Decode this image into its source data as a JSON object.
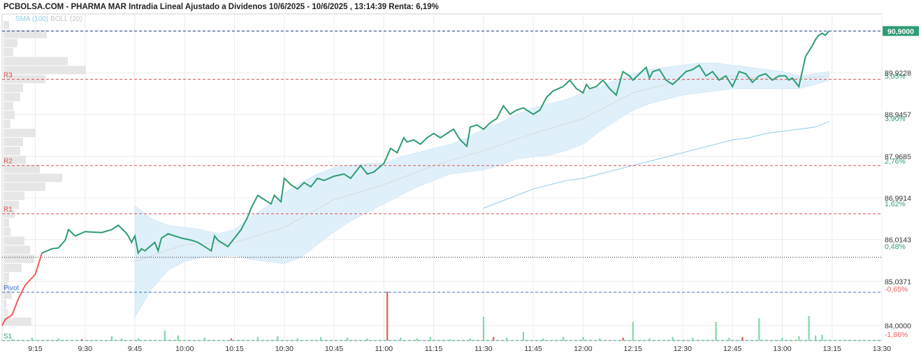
{
  "title": "PCBOLSA.COM - PHARMA MAR Intradia Lineal Ajustado a Dividenos 10/6/2025 - 10/6/2025 , 13:14:39 Renta: 6,19%",
  "legend": {
    "sma": "SMA (100)",
    "boll": "BOLL (20)"
  },
  "colors": {
    "price_up": "#2e9c72",
    "price_down": "#ef5a5a",
    "sma": "#8ccbe8",
    "boll_fill": "#dff0fb",
    "boll_line": "#d9d9d9",
    "volume_up": "#7ed9a6",
    "volume_down": "#ef5a5a",
    "level_resistance": "#e05050",
    "level_pivot": "#3c6fc2",
    "level_support": "#2e9c72",
    "last_price": "#233b8c",
    "grid": "#ececec",
    "volume_profile": "#e6e6e6"
  },
  "chart_data": {
    "type": "line",
    "title": "PCBOLSA.COM - PHARMA MAR Intradia Lineal Ajustado a Dividenos 10/6/2025 - 10/6/2025 , 13:14:39 Renta: 6,19%",
    "xlabel": "",
    "ylabel": "",
    "x_ticks": [
      "9:15",
      "9:30",
      "9:45",
      "10:00",
      "10:15",
      "10:30",
      "10:45",
      "11:00",
      "11:15",
      "11:30",
      "11:45",
      "12:00",
      "12:15",
      "12:30",
      "12:45",
      "13:00",
      "13:15",
      "13:30"
    ],
    "x_range": [
      "9:05",
      "13:30"
    ],
    "ylim": [
      83.65,
      91.3
    ],
    "y_ticks": [
      {
        "value": 84.0,
        "label": "84,0000"
      },
      {
        "value": 85.0371,
        "label": "85,0371"
      },
      {
        "value": 86.0143,
        "label": "86,0143"
      },
      {
        "value": 86.9914,
        "label": "86,9914"
      },
      {
        "value": 87.9685,
        "label": "87,9685"
      },
      {
        "value": 88.9457,
        "label": "88,9457"
      },
      {
        "value": 89.9228,
        "label": "89,9228"
      },
      {
        "value": 90.9,
        "label": "90,9000"
      }
    ],
    "pct_ticks": [
      {
        "value": 83.8,
        "label": "-1,86%"
      },
      {
        "value": 84.86,
        "label": "-0,65%"
      },
      {
        "value": 85.86,
        "label": "0,48%"
      },
      {
        "value": 86.86,
        "label": "1,62%"
      },
      {
        "value": 87.86,
        "label": "2,76%"
      },
      {
        "value": 88.86,
        "label": "3,90%"
      },
      {
        "value": 89.85,
        "label": "5,05%"
      }
    ],
    "last_price": {
      "value": 90.9,
      "label": "90,9000"
    },
    "reference_close": 85.6,
    "levels": [
      {
        "name": "R3",
        "value": 89.77,
        "kind": "resistance"
      },
      {
        "name": "R2",
        "value": 87.75,
        "kind": "resistance"
      },
      {
        "name": "R1",
        "value": 86.62,
        "kind": "resistance"
      },
      {
        "name": "Pivot",
        "value": 84.78,
        "kind": "pivot"
      },
      {
        "name": "S1",
        "value": 83.65,
        "kind": "support"
      }
    ],
    "series": [
      {
        "name": "Precio",
        "x": [
          "9:05",
          "9:06",
          "9:08",
          "9:10",
          "9:12",
          "9:15",
          "9:17",
          "9:20",
          "9:22",
          "9:24",
          "9:25",
          "9:27",
          "9:30",
          "9:35",
          "9:38",
          "9:40",
          "9:42",
          "9:43",
          "9:44",
          "9:45",
          "9:46",
          "9:47",
          "9:48",
          "9:51",
          "9:52",
          "9:53",
          "9:55",
          "9:57",
          "9:59",
          "10:02",
          "10:04",
          "10:06",
          "10:08",
          "10:09",
          "10:10",
          "10:11",
          "10:13",
          "10:15",
          "10:17",
          "10:19",
          "10:20",
          "10:22",
          "10:24",
          "10:26",
          "10:27",
          "10:29",
          "10:30",
          "10:32",
          "10:34",
          "10:36",
          "10:38",
          "10:40",
          "10:42",
          "10:45",
          "10:48",
          "10:50",
          "10:53",
          "10:55",
          "10:57",
          "11:00",
          "11:02",
          "11:04",
          "11:06",
          "11:07",
          "11:09",
          "11:11",
          "11:13",
          "11:15",
          "11:17",
          "11:19",
          "11:21",
          "11:23",
          "11:25",
          "11:26",
          "11:28",
          "11:30",
          "11:32",
          "11:34",
          "11:36",
          "11:38",
          "11:39",
          "11:40",
          "11:42",
          "11:45",
          "11:47",
          "11:49",
          "11:51",
          "11:54",
          "11:56",
          "11:58",
          "12:00",
          "12:01",
          "12:02",
          "12:04",
          "12:06",
          "12:08",
          "12:10",
          "12:12",
          "12:14",
          "12:15",
          "12:17",
          "12:19",
          "12:20",
          "12:21",
          "12:23",
          "12:25",
          "12:27",
          "12:29",
          "12:31",
          "12:33",
          "12:35",
          "12:37",
          "12:39",
          "12:41",
          "12:43",
          "12:45",
          "12:47",
          "12:49",
          "12:51",
          "12:53",
          "12:55",
          "12:57",
          "12:59",
          "13:01",
          "13:02",
          "13:03",
          "13:04",
          "13:05",
          "13:07",
          "13:09",
          "13:10",
          "13:11",
          "13:12",
          "13:13",
          "13:14"
        ],
        "values": [
          84.0,
          84.15,
          84.25,
          84.65,
          84.95,
          85.2,
          85.7,
          85.8,
          85.82,
          86.0,
          86.25,
          86.1,
          86.2,
          86.18,
          86.25,
          86.35,
          86.2,
          86.1,
          85.95,
          86.1,
          85.7,
          85.8,
          85.75,
          85.95,
          85.75,
          86.05,
          86.15,
          86.1,
          86.05,
          86.0,
          85.95,
          85.85,
          85.75,
          86.1,
          86.0,
          85.95,
          85.85,
          86.05,
          86.25,
          86.55,
          86.75,
          87.05,
          86.95,
          86.85,
          87.05,
          86.9,
          87.45,
          87.3,
          87.2,
          87.35,
          87.25,
          87.45,
          87.4,
          87.5,
          87.55,
          87.45,
          87.75,
          87.55,
          87.6,
          87.8,
          88.15,
          88.05,
          88.4,
          88.3,
          88.35,
          88.25,
          88.4,
          88.5,
          88.4,
          88.5,
          88.6,
          88.35,
          88.2,
          88.65,
          88.7,
          88.6,
          88.75,
          88.85,
          89.15,
          88.95,
          89.0,
          89.05,
          89.1,
          88.95,
          89.05,
          89.35,
          89.5,
          89.6,
          89.75,
          89.55,
          89.45,
          89.65,
          89.55,
          89.6,
          89.75,
          89.55,
          89.4,
          89.95,
          89.85,
          89.75,
          89.9,
          90.05,
          89.8,
          89.95,
          90.0,
          89.75,
          89.65,
          89.8,
          89.95,
          90.0,
          90.1,
          89.85,
          89.95,
          89.75,
          89.85,
          89.6,
          89.95,
          89.9,
          89.7,
          89.85,
          89.9,
          89.75,
          89.85,
          89.85,
          89.75,
          89.8,
          89.7,
          89.6,
          90.3,
          90.55,
          90.7,
          90.8,
          90.85,
          90.8,
          90.9
        ]
      },
      {
        "name": "SMA (100)",
        "x": [
          "11:30",
          "11:35",
          "11:40",
          "11:45",
          "11:50",
          "11:55",
          "12:00",
          "12:05",
          "12:10",
          "12:15",
          "12:20",
          "12:25",
          "12:30",
          "12:35",
          "12:40",
          "12:45",
          "12:50",
          "12:55",
          "13:00",
          "13:05",
          "13:10",
          "13:14"
        ],
        "values": [
          86.75,
          86.9,
          87.05,
          87.2,
          87.3,
          87.4,
          87.45,
          87.55,
          87.65,
          87.75,
          87.85,
          87.95,
          88.05,
          88.15,
          88.25,
          88.35,
          88.4,
          88.5,
          88.55,
          88.6,
          88.65,
          88.78
        ]
      },
      {
        "name": "BOLL (20) upper",
        "x": [
          "9:45",
          "9:50",
          "9:55",
          "10:00",
          "10:05",
          "10:10",
          "10:15",
          "10:20",
          "10:25",
          "10:30",
          "10:35",
          "10:40",
          "10:45",
          "10:50",
          "10:55",
          "11:00",
          "11:05",
          "11:10",
          "11:15",
          "11:20",
          "11:25",
          "11:30",
          "11:35",
          "11:40",
          "11:45",
          "11:50",
          "11:55",
          "12:00",
          "12:05",
          "12:10",
          "12:15",
          "12:20",
          "12:25",
          "12:30",
          "12:35",
          "12:40",
          "12:45",
          "12:50",
          "12:55",
          "13:00",
          "13:05",
          "13:10",
          "13:14"
        ],
        "values": [
          86.8,
          86.5,
          86.35,
          86.3,
          86.25,
          86.15,
          86.25,
          86.55,
          86.8,
          87.1,
          87.35,
          87.55,
          87.7,
          87.75,
          87.8,
          87.8,
          87.95,
          88.05,
          88.15,
          88.25,
          88.4,
          88.6,
          88.75,
          88.95,
          89.1,
          89.2,
          89.3,
          89.45,
          89.6,
          89.75,
          89.9,
          90.0,
          90.05,
          90.1,
          90.15,
          90.15,
          90.1,
          90.05,
          90.0,
          89.95,
          89.85,
          89.9,
          89.95
        ]
      },
      {
        "name": "BOLL (20) lower",
        "x": [
          "9:45",
          "9:50",
          "9:55",
          "10:00",
          "10:05",
          "10:10",
          "10:15",
          "10:20",
          "10:25",
          "10:30",
          "10:35",
          "10:40",
          "10:45",
          "10:50",
          "10:55",
          "11:00",
          "11:05",
          "11:10",
          "11:15",
          "11:20",
          "11:25",
          "11:30",
          "11:35",
          "11:40",
          "11:45",
          "11:50",
          "11:55",
          "12:00",
          "12:05",
          "12:10",
          "12:15",
          "12:20",
          "12:25",
          "12:30",
          "12:35",
          "12:40",
          "12:45",
          "12:50",
          "12:55",
          "13:00",
          "13:05",
          "13:10",
          "13:14"
        ],
        "values": [
          84.2,
          84.85,
          85.3,
          85.5,
          85.6,
          85.6,
          85.65,
          85.55,
          85.5,
          85.45,
          85.6,
          85.9,
          86.2,
          86.45,
          86.65,
          86.85,
          87.05,
          87.25,
          87.4,
          87.55,
          87.6,
          87.65,
          87.75,
          87.9,
          87.95,
          88.0,
          88.1,
          88.25,
          88.55,
          88.8,
          89.05,
          89.2,
          89.3,
          89.4,
          89.45,
          89.5,
          89.55,
          89.55,
          89.55,
          89.55,
          89.55,
          89.65,
          89.75
        ]
      },
      {
        "name": "BOLL (20) middle",
        "x": [
          "9:45",
          "10:00",
          "10:15",
          "10:30",
          "10:45",
          "11:00",
          "11:15",
          "11:30",
          "11:45",
          "12:00",
          "12:15",
          "12:30",
          "12:45",
          "13:00",
          "13:14"
        ],
        "values": [
          85.5,
          85.9,
          85.95,
          86.3,
          86.95,
          87.3,
          87.75,
          88.1,
          88.5,
          88.85,
          89.45,
          89.75,
          89.85,
          89.75,
          89.85
        ]
      },
      {
        "name": "Volumen",
        "x": [
          "9:08",
          "9:14",
          "9:22",
          "9:29",
          "9:38",
          "9:41",
          "9:46",
          "9:54",
          "9:58",
          "10:06",
          "10:14",
          "10:22",
          "10:28",
          "10:34",
          "10:41",
          "10:49",
          "10:55",
          "11:01",
          "11:05",
          "11:10",
          "11:14",
          "11:20",
          "11:26",
          "11:30",
          "11:33",
          "11:37",
          "11:42",
          "11:48",
          "11:54",
          "12:00",
          "12:05",
          "12:12",
          "12:15",
          "12:20",
          "12:27",
          "12:33",
          "12:40",
          "12:44",
          "12:48",
          "12:53",
          "13:00",
          "13:05",
          "13:08",
          "13:10",
          "13:12"
        ],
        "values": [
          2,
          4,
          3,
          2,
          6,
          3,
          3,
          14,
          7,
          4,
          3,
          5,
          6,
          3,
          5,
          4,
          3,
          68,
          4,
          3,
          5,
          2,
          3,
          33,
          5,
          4,
          12,
          3,
          5,
          5,
          3,
          4,
          26,
          3,
          5,
          4,
          26,
          4,
          5,
          31,
          4,
          6,
          34,
          7,
          8
        ]
      }
    ],
    "grid": true,
    "legend_position": "top-left"
  }
}
